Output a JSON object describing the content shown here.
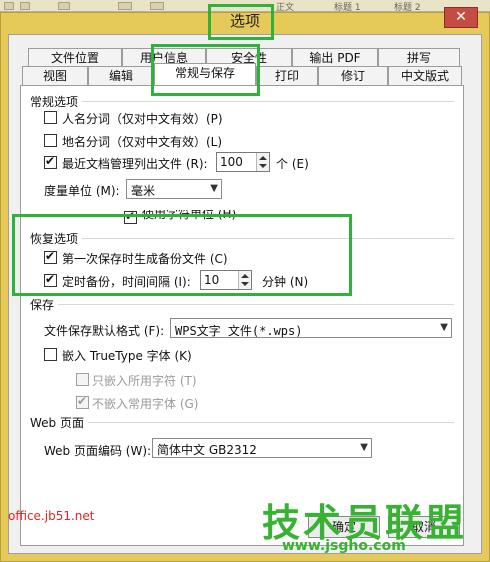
{
  "dialog": {
    "title": "选项",
    "close_glyph": "✕"
  },
  "background_app": {
    "tab_a": "标题 1",
    "tab_b": "标题 2",
    "tab_c": "正文"
  },
  "tabs_row1": [
    "文件位置",
    "用户信息",
    "安全性",
    "输出 PDF",
    "拼写"
  ],
  "tabs_row2": [
    "视图",
    "编辑",
    "常规与保存",
    "打印",
    "修订",
    "中文版式"
  ],
  "active_tab": "常规与保存",
  "general": {
    "title": "常规选项",
    "person_name": "人名分词（仅对中文有效）(P)",
    "place_name": "地名分词（仅对中文有效）(L)",
    "recent_files": "最近文档管理列出文件 (R):",
    "recent_count": "100",
    "recent_unit": "个 (E)",
    "unit_label": "度量单位 (M):",
    "unit_value": "毫米",
    "char_unit": "使用字符单位 (H)"
  },
  "recovery": {
    "title": "恢复选项",
    "backup_first": "第一次保存时生成备份文件 (C)",
    "timed_backup": "定时备份，时间间隔 (I):",
    "interval": "10",
    "interval_unit": "分钟 (N)"
  },
  "save": {
    "title": "保存",
    "format_label": "文件保存默认格式 (F):",
    "format_value": "WPS文字 文件(*.wps)",
    "embed_truetype": "嵌入 TrueType 字体 (K)",
    "embed_used_only": "只嵌入所用字符 (T)",
    "no_common_fonts": "不嵌入常用字体 (G)"
  },
  "web": {
    "title": "Web 页面",
    "encoding_label": "Web 页面编码 (W):",
    "encoding_value": "简体中文 GB2312"
  },
  "buttons": {
    "ok": "确定",
    "cancel": "取消"
  },
  "watermarks": {
    "site": "office.jb51.net",
    "logo": "技术员联盟",
    "url": "www.jsgho.com"
  },
  "colors": {
    "frame": "#e5ca5a",
    "close": "#c44c43",
    "highlight": "#2fb13a",
    "watermark_green": "#37b233",
    "watermark_red": "#e02525"
  }
}
